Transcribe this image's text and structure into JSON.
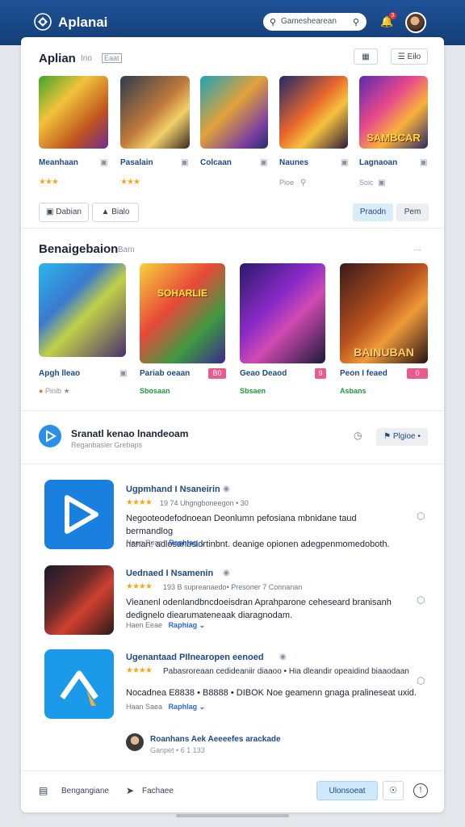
{
  "header": {
    "brand": "Aplanai",
    "search_placeholder": "Gameshearean",
    "notification_count": "3"
  },
  "section1": {
    "title": "Aplian",
    "sub1": "Ino",
    "sub2": "Eaat",
    "btn1": "",
    "btn2": "Eilo",
    "games": [
      {
        "caption": "",
        "name": "Meanhaan",
        "rating": "★★★"
      },
      {
        "caption": "",
        "name": "Pasalain",
        "rating": "★★★"
      },
      {
        "caption": "",
        "name": "Colcaan",
        "rating": "★★★"
      },
      {
        "caption": "",
        "name": "Naunes",
        "rating": "★★★"
      },
      {
        "caption": "SAMBCAR",
        "name": "Lagnaoan",
        "rating": "★★★"
      }
    ],
    "sublabel_4": "Pioe",
    "sublabel_5": "Soic",
    "filter1": "Dabian",
    "filter2": "Bialo",
    "action1": "Praodn",
    "action2": "Pem"
  },
  "section2": {
    "title": "Benaigebaion",
    "sub": "Bam",
    "games": [
      {
        "caption": "",
        "name": "Apgh lleao",
        "sub": "Pinib",
        "badge": "",
        "green": ""
      },
      {
        "caption": "SOHARLIE",
        "name": "Pariab oeaan",
        "sub": "",
        "badge": "B0",
        "green": "Sbosaan"
      },
      {
        "caption": "",
        "name": "Geao Deaod",
        "sub": "",
        "badge": "9",
        "green": "Sbsaen"
      },
      {
        "caption": "BAINUBAN",
        "name": "Peon I feaed",
        "sub": "",
        "badge": "0",
        "green": "Asbans"
      }
    ]
  },
  "featured": {
    "title": "Sranatl kenao lnandeoam",
    "subtitle": "Reganbasler Grebaps",
    "button": "Plgioe"
  },
  "list": [
    {
      "title": "Ugpmhand I Nsaneirin",
      "rating": "★★★★",
      "meta": "19 74 Uhgngboneegon • 30",
      "desc1": "Negooteodefodnoean Deonlumn pefosiana mbnidane taud bermandlog",
      "desc2": "nanan: adlosanbsidrtinbnt. deanige opionen adegpenmomedoboth.",
      "link1": "Naen Reae",
      "link2": "Raphlag"
    },
    {
      "title": "Uednaed I Nsamenin",
      "rating": "★★★★",
      "meta": "193 B  supreanaedo• Presoner 7 Connanan",
      "desc1": "Vieanenl odenlandbncdoeisdran Aprahparone ceheseard branisanh",
      "desc2": "dedignelo diearumateneaak diaragnodam.",
      "link1": "Haen Eeae",
      "link2": "Raphiag"
    },
    {
      "title": "Ugenantaad PIlnearopen eenoed",
      "rating": "★★★★",
      "meta": "Pabasroreaan cedideaniir diaaoo •  Hia dleandir opeaidind biaaodaan",
      "desc1": "",
      "desc2": "Nocadnea E8838 • B8888 • DIBOK  Noe geamenn gnaga pralineseat uxid.",
      "link1": "Haan Saea",
      "link2": "Raphlag"
    }
  ],
  "review": {
    "name": "Roanhans Aek Aeeeefes arackade",
    "sub": "Ganpet  •  6 1 133"
  },
  "bottom": {
    "nav1": "Bengangiane",
    "nav2": "Fachaee",
    "button": "Ulonsoeat"
  },
  "colors": {
    "header": "#1e5297",
    "accent": "#2a8fe8",
    "rating": "#f2a81d",
    "badge": "#ea5a8e",
    "positive": "#1e9a3b"
  }
}
